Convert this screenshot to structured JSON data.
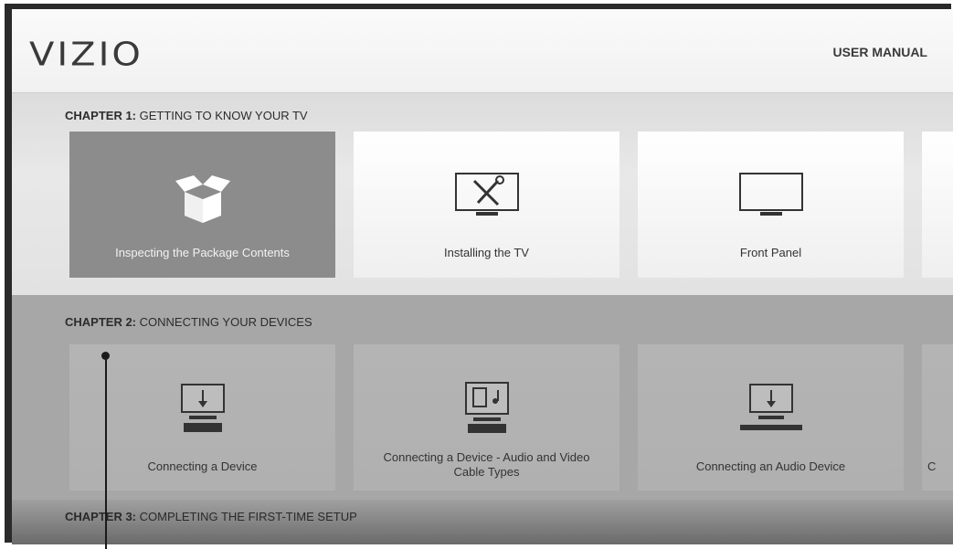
{
  "header": {
    "logo": "VIZIO",
    "user_manual": "USER MANUAL"
  },
  "chapters": [
    {
      "num": "CHAPTER 1:",
      "title": "GETTING TO KNOW YOUR TV",
      "cards": [
        {
          "label": "Inspecting the Package Contents",
          "icon": "open-box-icon",
          "active": true
        },
        {
          "label": "Installing the TV",
          "icon": "tv-tools-icon"
        },
        {
          "label": "Front Panel",
          "icon": "tv-icon"
        }
      ]
    },
    {
      "num": "CHAPTER 2:",
      "title": "CONNECTING YOUR DEVICES",
      "cards": [
        {
          "label": "Connecting a Device",
          "icon": "tv-device-icon"
        },
        {
          "label": "Connecting a Device - Audio and Video Cable Types",
          "icon": "tv-media-device-icon"
        },
        {
          "label": "Connecting an Audio Device",
          "icon": "tv-soundbar-icon"
        },
        {
          "label": "C"
        }
      ]
    },
    {
      "num": "CHAPTER 3:",
      "title": "COMPLETING THE FIRST-TIME SETUP"
    }
  ]
}
